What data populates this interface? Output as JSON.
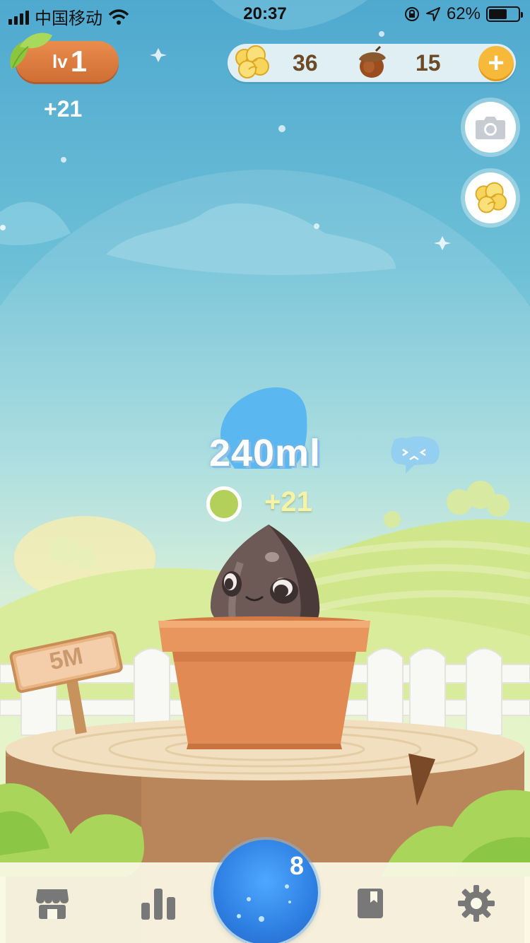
{
  "status_bar": {
    "carrier": "中国移动",
    "time": "20:37",
    "battery_percent": "62%",
    "battery_level": 0.62,
    "signal_bars": 4,
    "icons": [
      "signal-icon",
      "wifi-icon",
      "orientation-lock-icon",
      "location-arrow-icon",
      "battery-icon"
    ]
  },
  "level": {
    "prefix": "lv",
    "value": "1"
  },
  "gain_top": "+21",
  "currency": {
    "popcorn": "36",
    "acorn": "15",
    "add_label": "+"
  },
  "side_buttons": [
    "camera-icon",
    "popcorn-icon"
  ],
  "water": {
    "amount": "240ml",
    "gain": "+21"
  },
  "sign": {
    "text": "5M"
  },
  "nav": {
    "items": [
      "shop-icon",
      "stats-icon",
      "water-button",
      "bookmark-icon",
      "settings-icon"
    ],
    "water_count": "8"
  },
  "colors": {
    "sky_top": "#4fa9cf",
    "level_badge": "#e0803f",
    "add_button": "#f6b93a",
    "water_drop": "#5bb7f0",
    "water_button": "#2e7fe2",
    "pot": "#e28a53",
    "nav_icon": "#777777"
  }
}
